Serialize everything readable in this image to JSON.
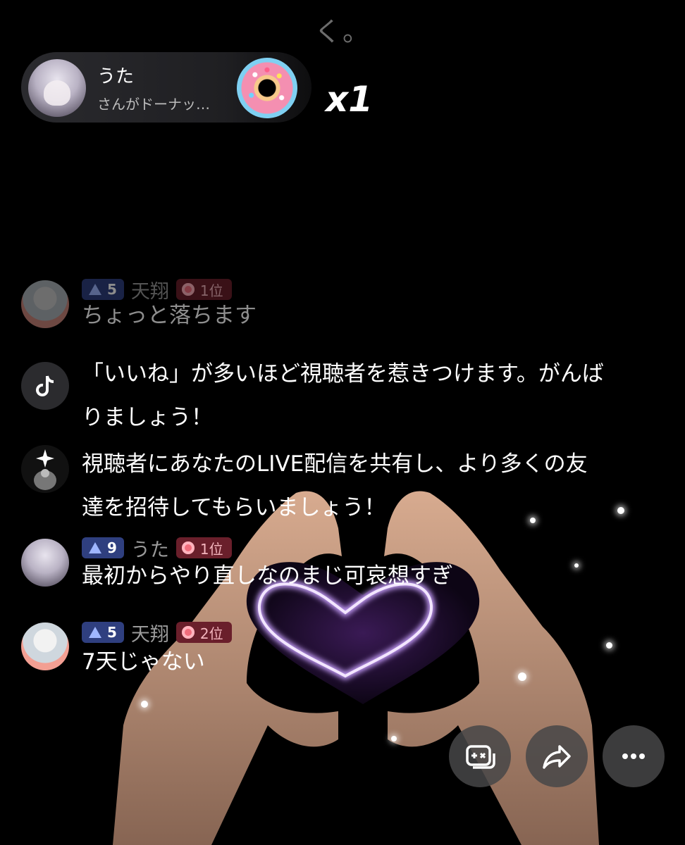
{
  "top_text": "く。",
  "gift": {
    "user_name": "うた",
    "subtitle": "さんがドーナッ…",
    "gift_icon": "donut-icon",
    "count": "x1"
  },
  "chat": [
    {
      "avatar": "seal-avatar",
      "level": "5",
      "name": "天翔",
      "rank": "1位",
      "text": "ちょっと落ちます"
    },
    {
      "avatar": "tiktok-icon",
      "system": true,
      "text": "「いいね」が多いほど視聴者を惹きつけます。がんば\nりましょう！"
    },
    {
      "avatar": "sparkle-avatar",
      "system": true,
      "text": "視聴者にあなたのLIVE配信を共有し、より多くの友\n達を招待してもらいましょう！"
    },
    {
      "avatar": "anime-avatar",
      "level": "9",
      "name": "うた",
      "rank": "1位",
      "text": "最初からやり直しなのまじ可哀想すぎ"
    },
    {
      "avatar": "seal-avatar",
      "level": "5",
      "name": "天翔",
      "rank": "2位",
      "text": "7天じゃない"
    }
  ],
  "actions": [
    {
      "icon": "game-controller-icon"
    },
    {
      "icon": "share-icon"
    },
    {
      "icon": "more-icon"
    }
  ],
  "colors": {
    "background": "#000000",
    "level_badge": "#2f3f7f",
    "rank_badge": "#6a1f2b",
    "heart_glow": "#d9b8ff"
  }
}
